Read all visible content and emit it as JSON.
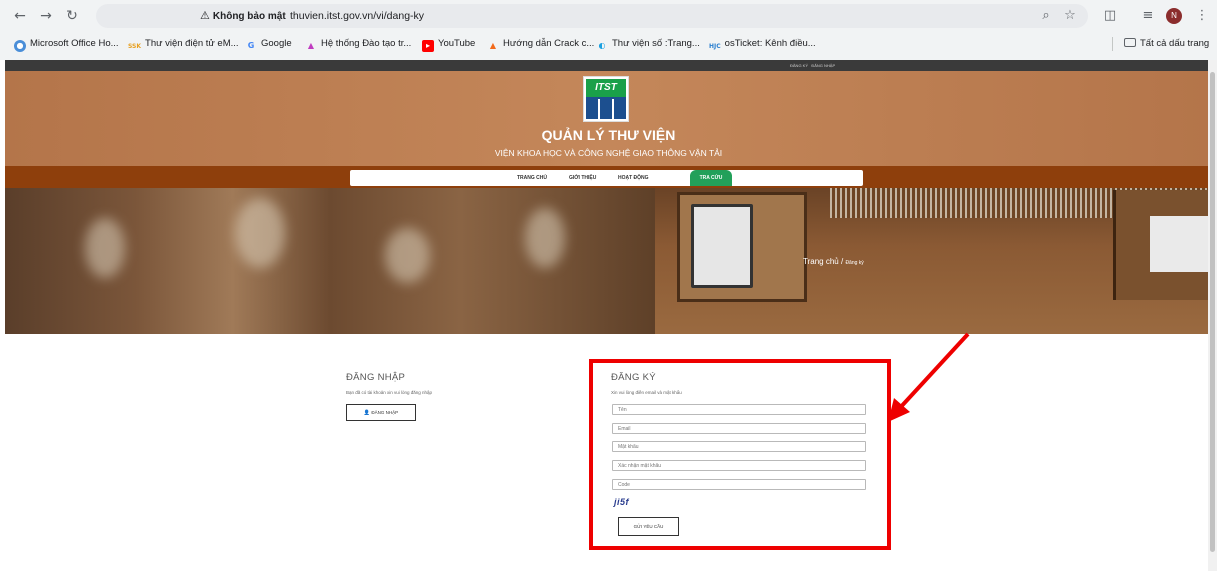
{
  "browser": {
    "security_label": "Không bảo mật",
    "url": "thuvien.itst.gov.vn/vi/dang-ky",
    "profile_initial": "N",
    "bookmarks": [
      "Microsoft Office Ho...",
      "Thư viện điện tử eM...",
      "Google",
      "Hệ thống Đào tạo tr...",
      "YouTube",
      "Hướng dẫn Crack c...",
      "Thư viện số :Trang...",
      "osTicket: Kênh điều..."
    ],
    "bookmark_icon_texts": [
      "SSK",
      "HJC"
    ],
    "all_bookmarks": "Tất cả dấu trang",
    "icons": [
      "back-icon",
      "forward-icon",
      "reload-icon",
      "zoom-icon",
      "star-icon",
      "extensions-icon",
      "reading-list-icon",
      "menu-icon",
      "folder-icon"
    ]
  },
  "site": {
    "top_links": [
      "ĐĂNG KÝ",
      "ĐĂNG NHẬP"
    ],
    "logo_text": "ITST",
    "title": "QUẢN LÝ THƯ VIỆN",
    "subtitle": "VIỆN KHOA HỌC VÀ CÔNG NGHỆ GIAO THÔNG VẬN TẢI",
    "nav": [
      "TRANG CHỦ",
      "GIỚI THIỆU",
      "HOẠT ĐỘNG",
      "TRA CỨU"
    ],
    "breadcrumb": {
      "home": "Trang chủ",
      "sep": "/",
      "current": "Đăng ký"
    }
  },
  "login": {
    "heading": "ĐĂNG NHẬP",
    "note": "Bạn đã có tài khoản xin vui lòng đăng nhập",
    "button": "ĐĂNG NHẬP"
  },
  "register": {
    "heading": "ĐĂNG KÝ",
    "note": "Xin vui lòng điền email và mật khẩu",
    "fields": [
      {
        "placeholder": "Tên",
        "value": ""
      },
      {
        "placeholder": "Email",
        "value": ""
      },
      {
        "placeholder": "Mật khẩu",
        "value": ""
      },
      {
        "placeholder": "Xác nhận mật khẩu",
        "value": ""
      },
      {
        "placeholder": "Code",
        "value": ""
      }
    ],
    "captcha": "ji5f",
    "submit": "GỬI YÊU CẦU"
  },
  "colors": {
    "header": "#c4875a",
    "nav_band": "#8e3f0c",
    "nav_active": "#22a05a",
    "annotation": "#ee0000"
  }
}
